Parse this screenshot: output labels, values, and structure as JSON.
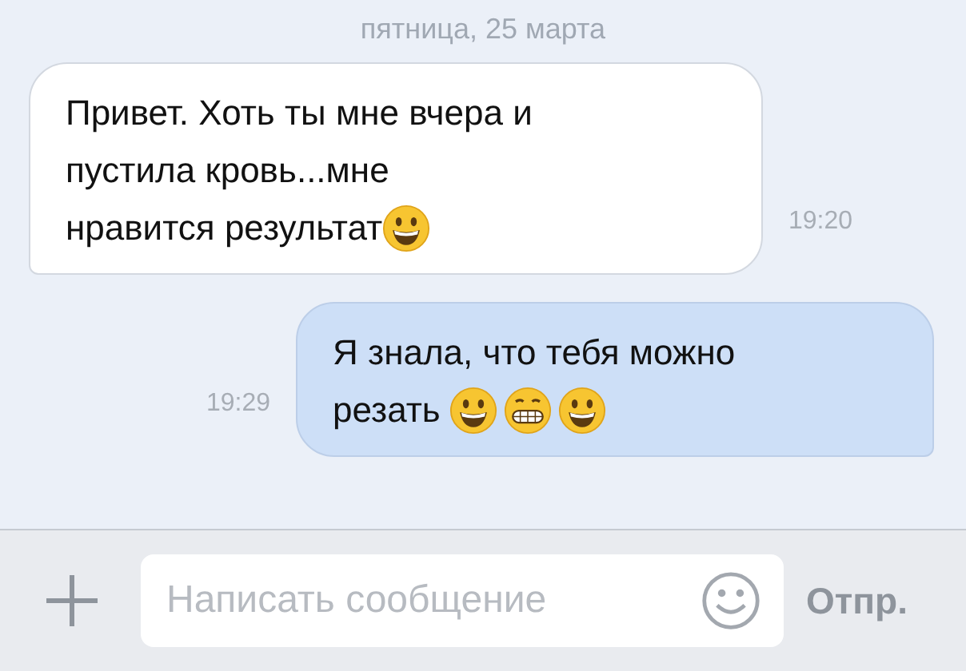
{
  "date_header": "пятница, 25 марта",
  "messages": [
    {
      "kind": "incoming",
      "lines": [
        "Привет. Хоть ты мне вчера и",
        "пустила кровь...мне",
        "нравится результат"
      ],
      "emojis": [
        {
          "kind": "smile"
        }
      ],
      "emoji_gap": false,
      "time": "19:20"
    },
    {
      "kind": "outgoing",
      "lines": [
        "Я знала, что тебя можно",
        "резать"
      ],
      "emojis": [
        {
          "kind": "smile"
        },
        {
          "kind": "grimace"
        },
        {
          "kind": "smile"
        }
      ],
      "emoji_gap": true,
      "time": "19:29"
    }
  ],
  "composer": {
    "placeholder": "Написать сообщение",
    "send_label": "Отпр."
  }
}
